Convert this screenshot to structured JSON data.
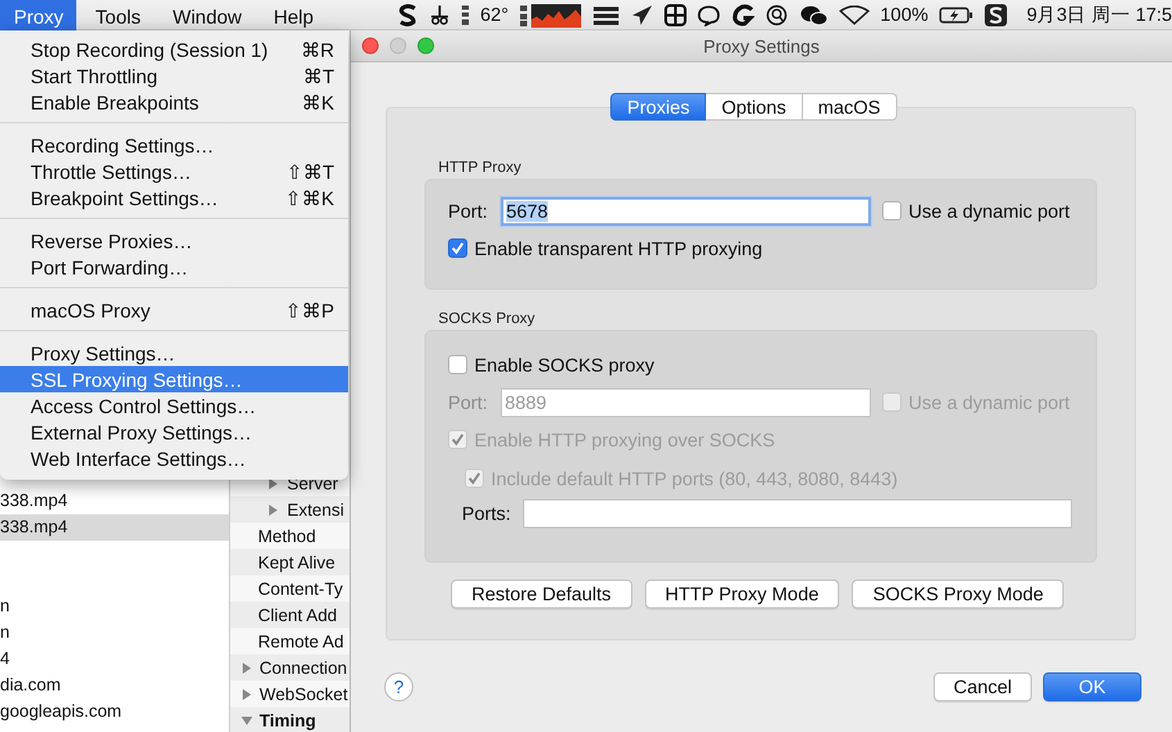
{
  "menubar": {
    "menus": [
      {
        "label": "Proxy",
        "selected": true
      },
      {
        "label": "Tools",
        "selected": false
      },
      {
        "label": "Window",
        "selected": false
      },
      {
        "label": "Help",
        "selected": false
      }
    ],
    "status": {
      "temperature": "62°",
      "battery": "100%",
      "clock": "9月3日 周一 17:5"
    }
  },
  "proxy_menu": {
    "groups": [
      [
        {
          "label": "Stop Recording (Session 1)",
          "shortcut": "⌘R",
          "selected": false
        },
        {
          "label": "Start Throttling",
          "shortcut": "⌘T",
          "selected": false
        },
        {
          "label": "Enable Breakpoints",
          "shortcut": "⌘K",
          "selected": false
        }
      ],
      [
        {
          "label": "Recording Settings…",
          "selected": false
        },
        {
          "label": "Throttle Settings…",
          "shortcut": "⇧⌘T",
          "selected": false
        },
        {
          "label": "Breakpoint Settings…",
          "shortcut": "⇧⌘K",
          "selected": false
        }
      ],
      [
        {
          "label": "Reverse Proxies…",
          "selected": false
        },
        {
          "label": "Port Forwarding…",
          "selected": false
        }
      ],
      [
        {
          "label": "macOS Proxy",
          "shortcut": "⇧⌘P",
          "selected": false
        }
      ],
      [
        {
          "label": "Proxy Settings…",
          "selected": false
        },
        {
          "label": "SSL Proxying Settings…",
          "selected": true
        },
        {
          "label": "Access Control Settings…",
          "selected": false
        },
        {
          "label": "External Proxy Settings…",
          "selected": false
        },
        {
          "label": "Web Interface Settings…",
          "selected": false
        }
      ]
    ]
  },
  "session": {
    "list_groups": [
      [
        {
          "text": "338.mp4",
          "selected": false
        },
        {
          "text": "338.mp4",
          "selected": true
        }
      ],
      [
        {
          "text": "n",
          "selected": false
        },
        {
          "text": "n",
          "selected": false
        },
        {
          "text": "4",
          "selected": false
        },
        {
          "text": "dia.com",
          "selected": false
        },
        {
          "text": "googleapis.com",
          "selected": false
        }
      ]
    ],
    "detail_rows": [
      {
        "text": "Server",
        "kind": "subsection"
      },
      {
        "text": "Extensi",
        "kind": "subsection"
      },
      {
        "text": "Method",
        "kind": "field"
      },
      {
        "text": "Kept Alive",
        "kind": "field"
      },
      {
        "text": "Content-Ty",
        "kind": "field"
      },
      {
        "text": "Client Add",
        "kind": "field"
      },
      {
        "text": "Remote Ad",
        "kind": "field"
      },
      {
        "text": "Connection",
        "kind": "section",
        "expanded": false
      },
      {
        "text": "WebSocket",
        "kind": "section",
        "expanded": false
      },
      {
        "text": "Timing",
        "kind": "section",
        "expanded": true
      }
    ]
  },
  "dialog": {
    "title": "Proxy Settings",
    "tabs": [
      {
        "label": "Proxies",
        "selected": true
      },
      {
        "label": "Options",
        "selected": false
      },
      {
        "label": "macOS",
        "selected": false
      }
    ],
    "http_proxy": {
      "heading": "HTTP Proxy",
      "port_label": "Port:",
      "port": "5678",
      "port_value_selected": true,
      "dynamic_port": {
        "label": "Use a dynamic port",
        "checked": false,
        "disabled": false
      },
      "transparent": {
        "label": "Enable transparent HTTP proxying",
        "checked": true,
        "disabled": false
      }
    },
    "socks_proxy": {
      "heading": "SOCKS Proxy",
      "enable": {
        "label": "Enable SOCKS proxy",
        "checked": false,
        "disabled": false
      },
      "port_label": "Port:",
      "port": "8889",
      "port_disabled": true,
      "dynamic_port": {
        "label": "Use a dynamic port",
        "checked": false,
        "disabled": true
      },
      "http_over_socks": {
        "label": "Enable HTTP proxying over SOCKS",
        "checked": true,
        "disabled": true
      },
      "include_default_ports": {
        "label": "Include default HTTP ports (80, 443, 8080, 8443)",
        "checked": true,
        "disabled": true
      },
      "ports_label": "Ports:"
    },
    "mode_buttons": [
      "Restore Defaults",
      "HTTP Proxy Mode",
      "SOCKS Proxy Mode"
    ],
    "help": "?",
    "buttons": [
      {
        "label": "Cancel",
        "default": false
      },
      {
        "label": "OK",
        "default": true
      }
    ]
  }
}
